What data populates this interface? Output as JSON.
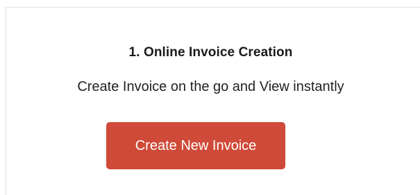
{
  "section": {
    "title": "1. Online Invoice Creation",
    "description": "Create Invoice on the go and View instantly",
    "button_label": "Create New Invoice"
  },
  "colors": {
    "button_bg": "#cf4a38",
    "button_text": "#ffffff",
    "title_text": "#1a1a1a",
    "border": "#dcdcdc"
  }
}
